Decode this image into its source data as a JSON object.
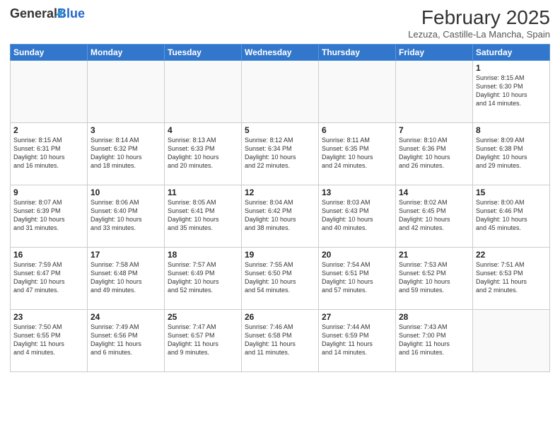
{
  "header": {
    "logo_general": "General",
    "logo_blue": "Blue",
    "month_title": "February 2025",
    "location": "Lezuza, Castille-La Mancha, Spain"
  },
  "weekdays": [
    "Sunday",
    "Monday",
    "Tuesday",
    "Wednesday",
    "Thursday",
    "Friday",
    "Saturday"
  ],
  "weeks": [
    [
      {
        "day": "",
        "info": ""
      },
      {
        "day": "",
        "info": ""
      },
      {
        "day": "",
        "info": ""
      },
      {
        "day": "",
        "info": ""
      },
      {
        "day": "",
        "info": ""
      },
      {
        "day": "",
        "info": ""
      },
      {
        "day": "1",
        "info": "Sunrise: 8:15 AM\nSunset: 6:30 PM\nDaylight: 10 hours\nand 14 minutes."
      }
    ],
    [
      {
        "day": "2",
        "info": "Sunrise: 8:15 AM\nSunset: 6:31 PM\nDaylight: 10 hours\nand 16 minutes."
      },
      {
        "day": "3",
        "info": "Sunrise: 8:14 AM\nSunset: 6:32 PM\nDaylight: 10 hours\nand 18 minutes."
      },
      {
        "day": "4",
        "info": "Sunrise: 8:13 AM\nSunset: 6:33 PM\nDaylight: 10 hours\nand 20 minutes."
      },
      {
        "day": "5",
        "info": "Sunrise: 8:12 AM\nSunset: 6:34 PM\nDaylight: 10 hours\nand 22 minutes."
      },
      {
        "day": "6",
        "info": "Sunrise: 8:11 AM\nSunset: 6:35 PM\nDaylight: 10 hours\nand 24 minutes."
      },
      {
        "day": "7",
        "info": "Sunrise: 8:10 AM\nSunset: 6:36 PM\nDaylight: 10 hours\nand 26 minutes."
      },
      {
        "day": "8",
        "info": "Sunrise: 8:09 AM\nSunset: 6:38 PM\nDaylight: 10 hours\nand 29 minutes."
      }
    ],
    [
      {
        "day": "9",
        "info": "Sunrise: 8:07 AM\nSunset: 6:39 PM\nDaylight: 10 hours\nand 31 minutes."
      },
      {
        "day": "10",
        "info": "Sunrise: 8:06 AM\nSunset: 6:40 PM\nDaylight: 10 hours\nand 33 minutes."
      },
      {
        "day": "11",
        "info": "Sunrise: 8:05 AM\nSunset: 6:41 PM\nDaylight: 10 hours\nand 35 minutes."
      },
      {
        "day": "12",
        "info": "Sunrise: 8:04 AM\nSunset: 6:42 PM\nDaylight: 10 hours\nand 38 minutes."
      },
      {
        "day": "13",
        "info": "Sunrise: 8:03 AM\nSunset: 6:43 PM\nDaylight: 10 hours\nand 40 minutes."
      },
      {
        "day": "14",
        "info": "Sunrise: 8:02 AM\nSunset: 6:45 PM\nDaylight: 10 hours\nand 42 minutes."
      },
      {
        "day": "15",
        "info": "Sunrise: 8:00 AM\nSunset: 6:46 PM\nDaylight: 10 hours\nand 45 minutes."
      }
    ],
    [
      {
        "day": "16",
        "info": "Sunrise: 7:59 AM\nSunset: 6:47 PM\nDaylight: 10 hours\nand 47 minutes."
      },
      {
        "day": "17",
        "info": "Sunrise: 7:58 AM\nSunset: 6:48 PM\nDaylight: 10 hours\nand 49 minutes."
      },
      {
        "day": "18",
        "info": "Sunrise: 7:57 AM\nSunset: 6:49 PM\nDaylight: 10 hours\nand 52 minutes."
      },
      {
        "day": "19",
        "info": "Sunrise: 7:55 AM\nSunset: 6:50 PM\nDaylight: 10 hours\nand 54 minutes."
      },
      {
        "day": "20",
        "info": "Sunrise: 7:54 AM\nSunset: 6:51 PM\nDaylight: 10 hours\nand 57 minutes."
      },
      {
        "day": "21",
        "info": "Sunrise: 7:53 AM\nSunset: 6:52 PM\nDaylight: 10 hours\nand 59 minutes."
      },
      {
        "day": "22",
        "info": "Sunrise: 7:51 AM\nSunset: 6:53 PM\nDaylight: 11 hours\nand 2 minutes."
      }
    ],
    [
      {
        "day": "23",
        "info": "Sunrise: 7:50 AM\nSunset: 6:55 PM\nDaylight: 11 hours\nand 4 minutes."
      },
      {
        "day": "24",
        "info": "Sunrise: 7:49 AM\nSunset: 6:56 PM\nDaylight: 11 hours\nand 6 minutes."
      },
      {
        "day": "25",
        "info": "Sunrise: 7:47 AM\nSunset: 6:57 PM\nDaylight: 11 hours\nand 9 minutes."
      },
      {
        "day": "26",
        "info": "Sunrise: 7:46 AM\nSunset: 6:58 PM\nDaylight: 11 hours\nand 11 minutes."
      },
      {
        "day": "27",
        "info": "Sunrise: 7:44 AM\nSunset: 6:59 PM\nDaylight: 11 hours\nand 14 minutes."
      },
      {
        "day": "28",
        "info": "Sunrise: 7:43 AM\nSunset: 7:00 PM\nDaylight: 11 hours\nand 16 minutes."
      },
      {
        "day": "",
        "info": ""
      }
    ]
  ]
}
